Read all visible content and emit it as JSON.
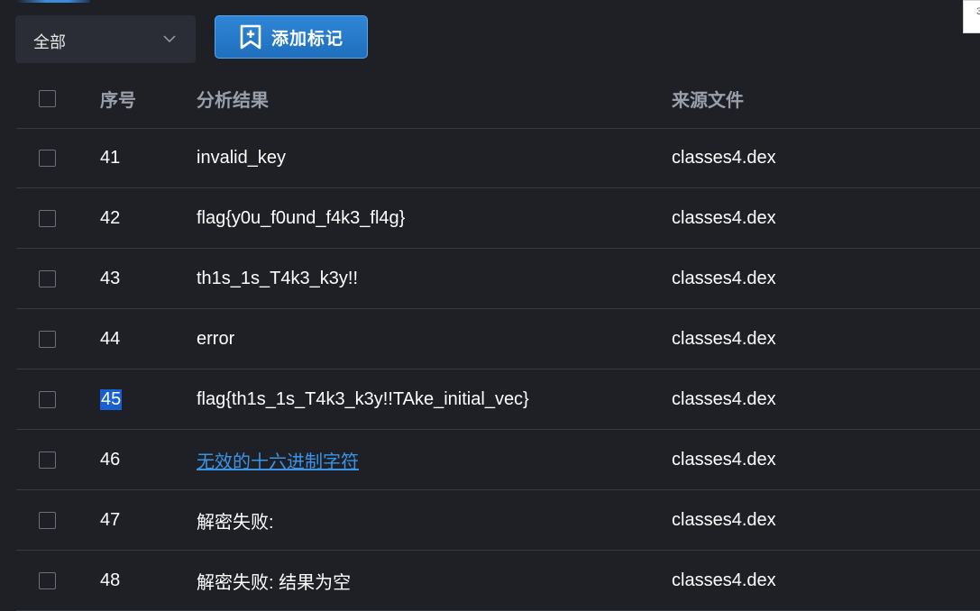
{
  "filter": {
    "value": "全部"
  },
  "toolbar": {
    "add_label": "添加标记"
  },
  "corner": {
    "glyph": "3"
  },
  "table": {
    "headers": {
      "id": "序号",
      "result": "分析结果",
      "source": "来源文件"
    },
    "rows": [
      {
        "id": "41",
        "result": "invalid_key",
        "source": "classes4.dex"
      },
      {
        "id": "42",
        "result": "flag{y0u_f0und_f4k3_fl4g}",
        "source": "classes4.dex"
      },
      {
        "id": "43",
        "result": "th1s_1s_T4k3_k3y!!",
        "source": "classes4.dex"
      },
      {
        "id": "44",
        "result": "error",
        "source": "classes4.dex"
      },
      {
        "id": "45",
        "result": "flag{th1s_1s_T4k3_k3y!!TAke_initial_vec}",
        "source": "classes4.dex"
      },
      {
        "id": "46",
        "result": "无效的十六进制字符",
        "source": "classes4.dex"
      },
      {
        "id": "47",
        "result": "解密失败:",
        "source": "classes4.dex"
      },
      {
        "id": "48",
        "result": "解密失败: 结果为空",
        "source": "classes4.dex"
      }
    ]
  },
  "colors": {
    "background": "#1e2026",
    "accent": "#2f86d6",
    "link": "#3b94e6",
    "selection": "#1a5fd1"
  }
}
